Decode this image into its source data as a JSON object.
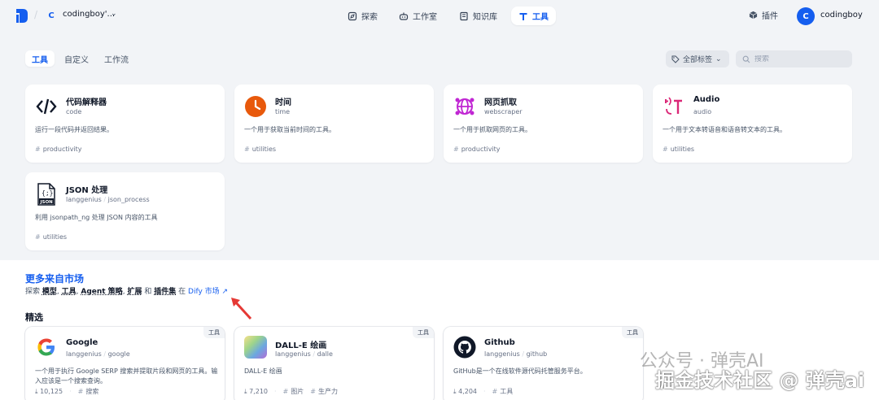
{
  "header": {
    "workspace_initial": "C",
    "workspace_name": "codingboy'...",
    "nav": [
      {
        "label": "探索"
      },
      {
        "label": "工作室"
      },
      {
        "label": "知识库"
      },
      {
        "label": "工具"
      }
    ],
    "plugin_label": "插件",
    "user_initial": "C",
    "user_name": "codingboy"
  },
  "tabs": [
    {
      "label": "工具"
    },
    {
      "label": "自定义"
    },
    {
      "label": "工作流"
    }
  ],
  "filter": {
    "tags_label": "全部标签",
    "search_placeholder": "搜索"
  },
  "tools": [
    {
      "name": "代码解释器",
      "sub": "code",
      "desc": "运行一段代码并返回结果。",
      "tag": "productivity",
      "icon": "code-icon"
    },
    {
      "name": "时间",
      "sub": "time",
      "desc": "一个用于获取当前时间的工具。",
      "tag": "utilities",
      "icon": "clock-icon"
    },
    {
      "name": "网页抓取",
      "sub": "webscraper",
      "desc": "一个用于抓取网页的工具。",
      "tag": "productivity",
      "icon": "web-icon"
    },
    {
      "name": "Audio",
      "sub": "audio",
      "desc": "一个用于文本转语音和语音转文本的工具。",
      "tag": "utilities",
      "icon": "audio-icon"
    },
    {
      "name": "JSON 处理",
      "sub_a": "langgenius",
      "sub_b": "json_process",
      "desc": "利用 jsonpath_ng 处理 JSON 内容的工具",
      "tag": "utilities",
      "icon": "json-icon"
    }
  ],
  "market": {
    "title": "更多来自市场",
    "line_prefix": "探索",
    "words": [
      "模型",
      "工具",
      "Agent 策略",
      "扩展"
    ],
    "and": "和",
    "last_word": "插件集",
    "in": "在",
    "link": "Dify 市场 ↗",
    "featured": "精选"
  },
  "featured_cards": [
    {
      "badge": "工具",
      "name": "Google",
      "author": "langgenius",
      "slug": "google",
      "desc": "一个用于执行 Google SERP 搜索并提取片段和网页的工具。输入应该是一个搜索查询。",
      "installs": "10,125",
      "tags": [
        "搜索"
      ],
      "icon": "google-icon"
    },
    {
      "badge": "工具",
      "name": "DALL-E 绘画",
      "author": "langgenius",
      "slug": "dalle",
      "desc": "DALL-E 绘画",
      "installs": "7,210",
      "tags": [
        "图片",
        "生产力"
      ],
      "icon": "dalle-icon"
    },
    {
      "badge": "工具",
      "name": "Github",
      "author": "langgenius",
      "slug": "github",
      "desc": "GitHub是一个在线软件源代码托管服务平台。",
      "installs": "4,204",
      "tags": [
        "工具"
      ],
      "icon": "github-icon"
    }
  ],
  "watermark": {
    "line1": "公众号 · 弹壳AI",
    "line2": "掘金技术社区 @ 弹壳ai"
  }
}
